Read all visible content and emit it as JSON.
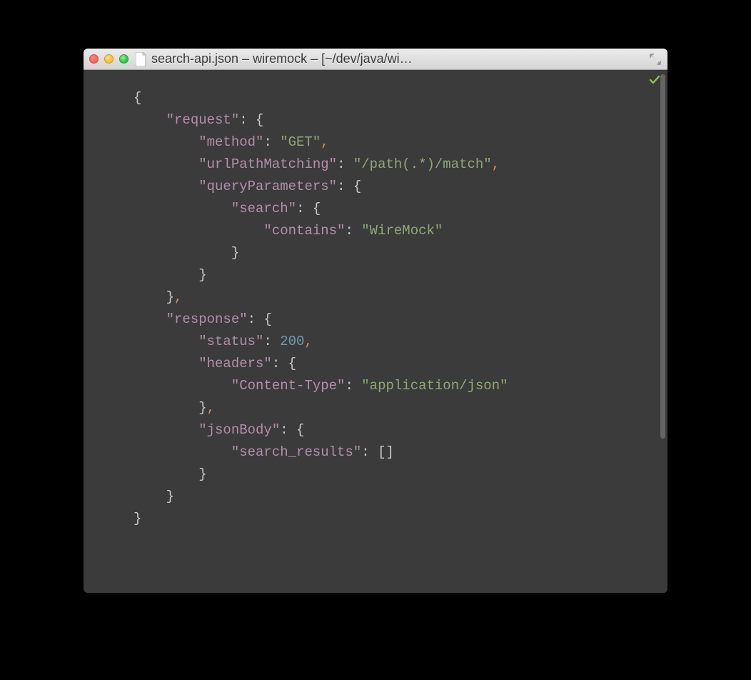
{
  "window": {
    "title": "search-api.json – wiremock – [~/dev/java/wi…"
  },
  "code": {
    "l1": "{",
    "l2_key": "\"request\"",
    "l2_after": ": {",
    "l3_key": "\"method\"",
    "l3_colon": ": ",
    "l3_val": "\"GET\"",
    "l3_end": ",",
    "l4_key": "\"urlPathMatching\"",
    "l4_colon": ": ",
    "l4_val": "\"/path(.*)/match\"",
    "l4_end": ",",
    "l5_key": "\"queryParameters\"",
    "l5_after": ": {",
    "l6_key": "\"search\"",
    "l6_after": ": {",
    "l7_key": "\"contains\"",
    "l7_colon": ": ",
    "l7_val": "\"WireMock\"",
    "l8": "}",
    "l9": "}",
    "l10": "}",
    "l10_end": ",",
    "l11_key": "\"response\"",
    "l11_after": ": {",
    "l12_key": "\"status\"",
    "l12_colon": ": ",
    "l12_val": "200",
    "l12_end": ",",
    "l13_key": "\"headers\"",
    "l13_after": ": {",
    "l14_key": "\"Content-Type\"",
    "l14_colon": ": ",
    "l14_val": "\"application/json\"",
    "l15": "}",
    "l15_end": ",",
    "l16_key": "\"jsonBody\"",
    "l16_after": ": {",
    "l17_key": "\"search_results\"",
    "l17_colon": ": ",
    "l17_val": "[]",
    "l18": "}",
    "l19": "}",
    "l20": "}"
  },
  "indent": {
    "i0": "",
    "i1": "    ",
    "i2": "        ",
    "i3": "            ",
    "i4": "                "
  }
}
